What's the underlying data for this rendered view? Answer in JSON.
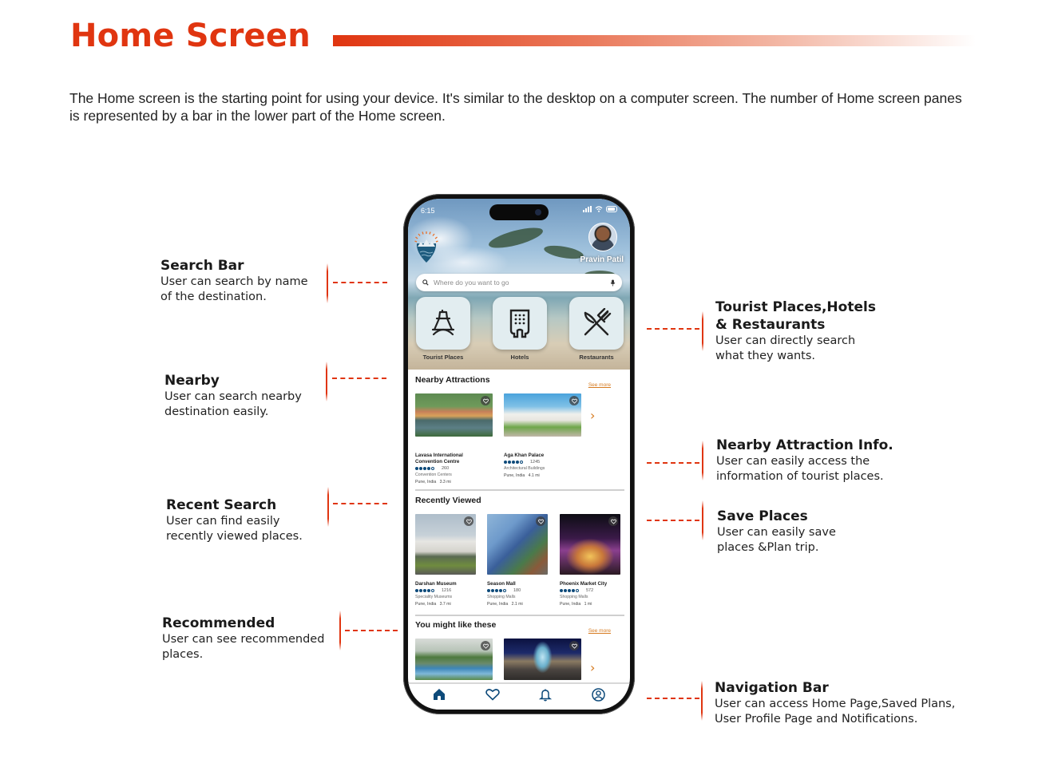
{
  "header": {
    "title": "Home Screen",
    "intro": "The Home screen is the starting point for using your device. It's similar to the desktop on a computer screen. The number of Home screen panes is represented by a bar in the lower part of the Home screen.",
    "accent_color": "#e03510"
  },
  "annotations": {
    "search_bar": {
      "title": "Search Bar",
      "desc": "User can search by name\n of the destination."
    },
    "nearby": {
      "title": "Nearby",
      "desc": "User can search nearby\ndestination easily."
    },
    "recent_search": {
      "title": "Recent Search",
      "desc": "User can find easily\nrecently viewed places."
    },
    "recommended": {
      "title": "Recommended",
      "desc": "User can see recommended\nplaces."
    },
    "categories": {
      "title": "Tourist Places,Hotels\n& Restaurants",
      "desc": "User can directly search\nwhat they wants."
    },
    "nearby_info": {
      "title": "Nearby Attraction Info.",
      "desc": "User can easily access the\ninformation of tourist places."
    },
    "save_places": {
      "title": "Save Places",
      "desc": "User can easily save\nplaces &Plan trip."
    },
    "navigation_bar": {
      "title": "Navigation Bar",
      "desc": "User can access Home Page,Saved Plans,\nUser Profile Page and Notifications."
    }
  },
  "phone": {
    "status_time": "6:15",
    "user_name": "Pravin Patil",
    "search_placeholder": "Where do you want to go",
    "categories": [
      {
        "label": "Tourist Places",
        "icon": "eiffel-tower-icon"
      },
      {
        "label": "Hotels",
        "icon": "hotel-building-icon"
      },
      {
        "label": "Restaurants",
        "icon": "fork-knife-icon"
      }
    ],
    "nearby": {
      "title": "Nearby Attractions",
      "see_more": "See more",
      "items": [
        {
          "name": "Lavasa International Convention Centre",
          "rating": 4,
          "reviews": "260",
          "category": "Convention Centers",
          "location": "Pune, India",
          "distance": "3.3 mi"
        },
        {
          "name": "Aga Khan Palace",
          "rating": 4,
          "reviews": "1245",
          "category": "Architectural Buildings",
          "location": "Pune, India",
          "distance": "4.1 mi"
        }
      ]
    },
    "recent": {
      "title": "Recently Viewed",
      "items": [
        {
          "name": "Darshan Museum",
          "rating": 4,
          "reviews": "1216",
          "category": "Speciality Museums",
          "location": "Pune, India",
          "distance": "3.7 mi"
        },
        {
          "name": "Season Mall",
          "rating": 4,
          "reviews": "180",
          "category": "Shopping Malls",
          "location": "Pune, India",
          "distance": "2.1 mi"
        },
        {
          "name": "Phoenix Market City",
          "rating": 4,
          "reviews": "572",
          "category": "Shopping Malls",
          "location": "Pune, India",
          "distance": "1 mi"
        }
      ]
    },
    "recommended": {
      "title": "You might like these",
      "see_more": "See more"
    },
    "nav": [
      "home-icon",
      "heart-icon",
      "bell-icon",
      "profile-icon"
    ],
    "nav_color": "#0d4a7a",
    "link_color": "#d67a1f"
  }
}
